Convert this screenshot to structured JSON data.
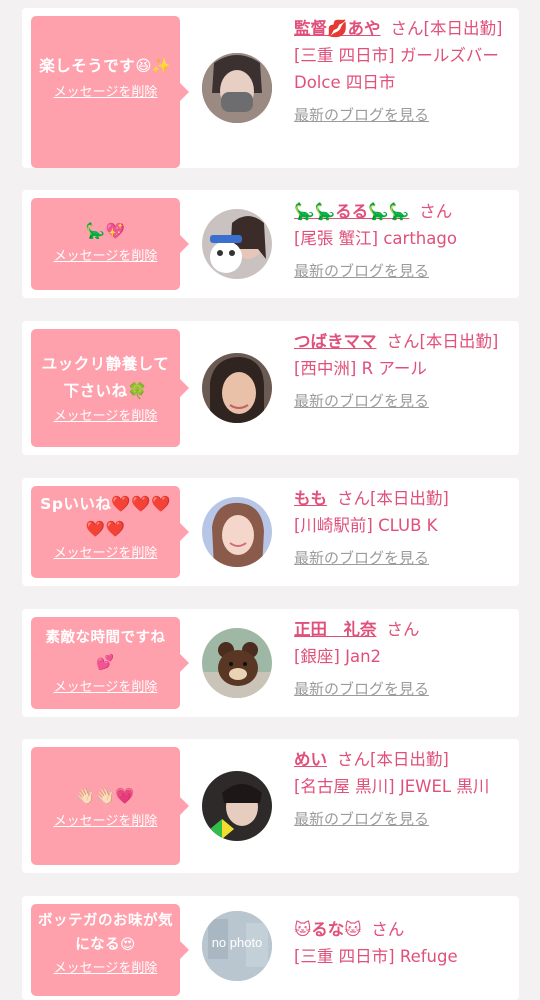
{
  "delete_label": "メッセージを削除",
  "blog_label": "最新のブログを見る",
  "items": [
    {
      "message": "楽しそうです😆✨",
      "name": "監督💋あや",
      "suffix": "さん[本日出勤]",
      "shop": "[三重 四日市] ガールズバー Dolce 四日市",
      "avatar_icon": "masked-woman-photo"
    },
    {
      "message": "🦕💖",
      "name": "🦕🦕るる🦕🦕",
      "suffix": "さん",
      "shop": "[尾張 蟹江] carthago",
      "avatar_icon": "woman-with-plush-photo"
    },
    {
      "message": "ユックリ静養して下さいね🍀",
      "name": "つばきママ",
      "suffix": "さん[本日出勤]",
      "shop": "[西中洲] R アール",
      "avatar_icon": "woman-portrait-photo"
    },
    {
      "message": "Spいいね❤️❤️❤️❤️❤️",
      "name": "もも",
      "suffix": "さん[本日出勤]",
      "shop": "[川崎駅前] CLUB K",
      "avatar_icon": "smiling-woman-photo"
    },
    {
      "message": "素敵な時間ですね💕",
      "name": "正田　礼奈",
      "suffix": "さん",
      "shop": "[銀座] Jan2",
      "avatar_icon": "brown-bear-photo"
    },
    {
      "message": "👋🏻👋🏻💗",
      "name": "めい",
      "suffix": "さん[本日出勤]",
      "shop": "[名古屋 黒川] JEWEL 黒川",
      "avatar_icon": "woman-with-badge-photo"
    },
    {
      "message": "ボッテガのお味が気になる😍",
      "name": "🐱るな🐱",
      "suffix": "さん",
      "shop": "[三重 四日市] Refuge",
      "avatar_icon": "no-photo-placeholder",
      "avatar_text": "no photo"
    }
  ]
}
